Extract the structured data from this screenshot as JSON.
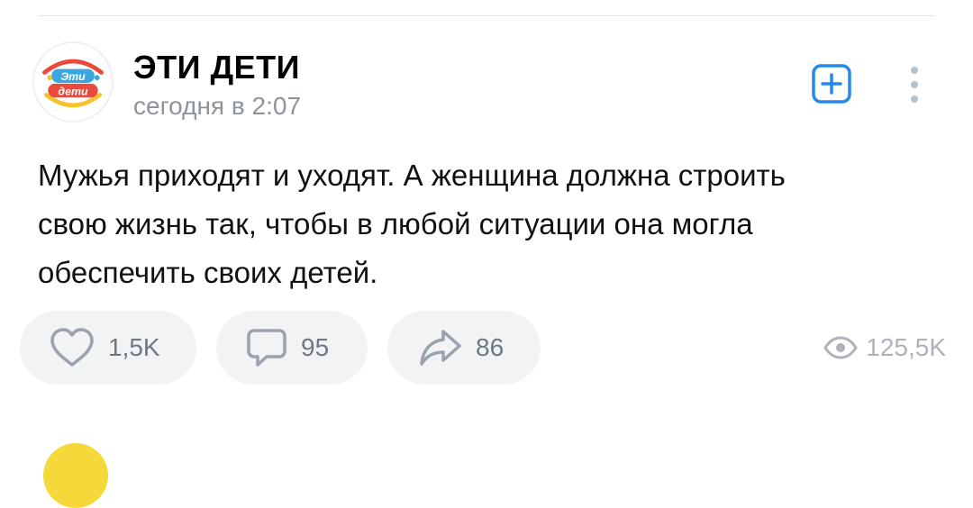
{
  "post": {
    "author": {
      "name": "ЭТИ ДЕТИ",
      "avatar_logo_text": [
        "Эти",
        "дети"
      ],
      "avatar_icon": "eti-deti-logo"
    },
    "time": "сегодня в 2:07",
    "text": "Мужья приходят и уходят. А женщина должна строить\nсвою жизнь так, чтобы в любой ситуации она могла\nобеспечить своих детей.",
    "header_actions": {
      "subscribe_icon": "plus-square-icon",
      "more_icon": "more-vertical-icon"
    },
    "reactions": {
      "likes": {
        "icon": "heart-outline-icon",
        "count": "1,5K"
      },
      "comments": {
        "icon": "comment-icon",
        "count": "95"
      },
      "shares": {
        "icon": "share-arrow-icon",
        "count": "86"
      },
      "views": {
        "icon": "eye-icon",
        "count": "125,5K"
      }
    }
  },
  "colors": {
    "accent": "#2688eb",
    "secondary_text": "#8e949b",
    "pill_background": "#f2f3f5",
    "icon_gray": "#99a2ad",
    "views_gray": "#aeb3b9"
  }
}
